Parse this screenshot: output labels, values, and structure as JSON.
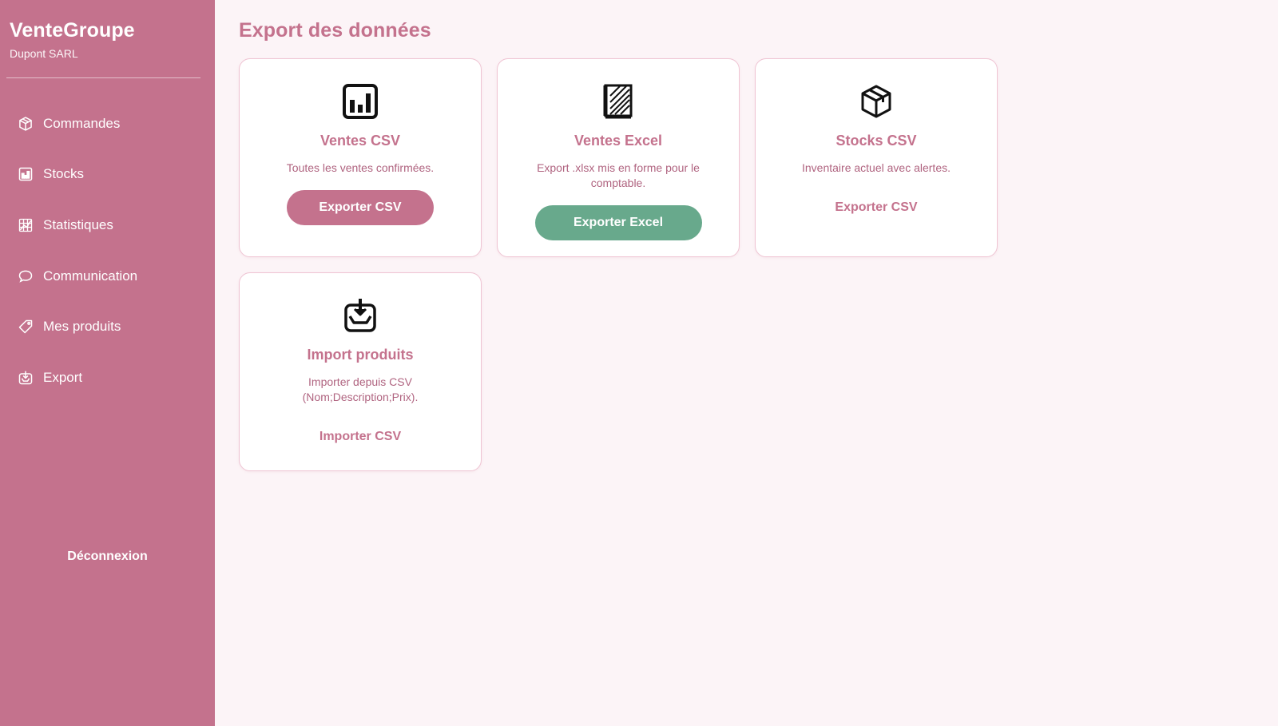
{
  "brand": {
    "title": "VenteGroupe",
    "subtitle": "Dupont SARL"
  },
  "sidebar": {
    "items": [
      {
        "label": "Commandes",
        "icon": "package-icon"
      },
      {
        "label": "Stocks",
        "icon": "bar-chart-icon"
      },
      {
        "label": "Statistiques",
        "icon": "grid-chart-icon"
      },
      {
        "label": "Communication",
        "icon": "speech-bubble-icon"
      },
      {
        "label": "Mes produits",
        "icon": "tag-icon"
      },
      {
        "label": "Export",
        "icon": "inbox-download-icon"
      }
    ],
    "logout_label": "Déconnexion"
  },
  "main": {
    "title": "Export des données",
    "cards": [
      {
        "title": "Ventes CSV",
        "description": "Toutes les ventes confirmées.",
        "button_label": "Exporter CSV",
        "icon": "bar-chart-icon"
      },
      {
        "title": "Ventes Excel",
        "description": "Export .xlsx mis en forme pour le comptable.",
        "button_label": "Exporter Excel",
        "icon": "ledger-icon"
      },
      {
        "title": "Stocks CSV",
        "description": "Inventaire actuel avec alertes.",
        "button_label": "Exporter CSV",
        "icon": "package-icon"
      },
      {
        "title": "Import produits",
        "description": "Importer depuis CSV (Nom;Description;Prix).",
        "button_label": "Importer CSV",
        "icon": "inbox-download-icon"
      }
    ]
  },
  "colors": {
    "sidebar_bg": "#c4728d",
    "page_bg": "#fcf4f7",
    "accent_pink": "#c4728d",
    "accent_green": "#68a98c",
    "card_border": "#efc4d3"
  }
}
